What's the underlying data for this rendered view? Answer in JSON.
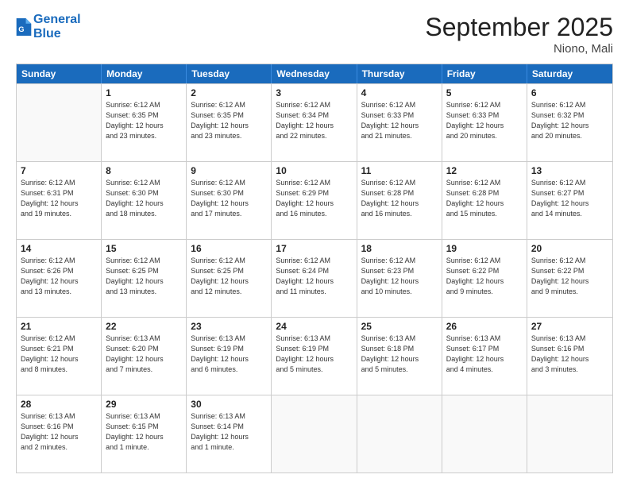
{
  "logo": {
    "line1": "General",
    "line2": "Blue"
  },
  "title": "September 2025",
  "location": "Niono, Mali",
  "header_days": [
    "Sunday",
    "Monday",
    "Tuesday",
    "Wednesday",
    "Thursday",
    "Friday",
    "Saturday"
  ],
  "rows": [
    [
      {
        "day": "",
        "info": ""
      },
      {
        "day": "1",
        "info": "Sunrise: 6:12 AM\nSunset: 6:35 PM\nDaylight: 12 hours\nand 23 minutes."
      },
      {
        "day": "2",
        "info": "Sunrise: 6:12 AM\nSunset: 6:35 PM\nDaylight: 12 hours\nand 23 minutes."
      },
      {
        "day": "3",
        "info": "Sunrise: 6:12 AM\nSunset: 6:34 PM\nDaylight: 12 hours\nand 22 minutes."
      },
      {
        "day": "4",
        "info": "Sunrise: 6:12 AM\nSunset: 6:33 PM\nDaylight: 12 hours\nand 21 minutes."
      },
      {
        "day": "5",
        "info": "Sunrise: 6:12 AM\nSunset: 6:33 PM\nDaylight: 12 hours\nand 20 minutes."
      },
      {
        "day": "6",
        "info": "Sunrise: 6:12 AM\nSunset: 6:32 PM\nDaylight: 12 hours\nand 20 minutes."
      }
    ],
    [
      {
        "day": "7",
        "info": "Sunrise: 6:12 AM\nSunset: 6:31 PM\nDaylight: 12 hours\nand 19 minutes."
      },
      {
        "day": "8",
        "info": "Sunrise: 6:12 AM\nSunset: 6:30 PM\nDaylight: 12 hours\nand 18 minutes."
      },
      {
        "day": "9",
        "info": "Sunrise: 6:12 AM\nSunset: 6:30 PM\nDaylight: 12 hours\nand 17 minutes."
      },
      {
        "day": "10",
        "info": "Sunrise: 6:12 AM\nSunset: 6:29 PM\nDaylight: 12 hours\nand 16 minutes."
      },
      {
        "day": "11",
        "info": "Sunrise: 6:12 AM\nSunset: 6:28 PM\nDaylight: 12 hours\nand 16 minutes."
      },
      {
        "day": "12",
        "info": "Sunrise: 6:12 AM\nSunset: 6:28 PM\nDaylight: 12 hours\nand 15 minutes."
      },
      {
        "day": "13",
        "info": "Sunrise: 6:12 AM\nSunset: 6:27 PM\nDaylight: 12 hours\nand 14 minutes."
      }
    ],
    [
      {
        "day": "14",
        "info": "Sunrise: 6:12 AM\nSunset: 6:26 PM\nDaylight: 12 hours\nand 13 minutes."
      },
      {
        "day": "15",
        "info": "Sunrise: 6:12 AM\nSunset: 6:25 PM\nDaylight: 12 hours\nand 13 minutes."
      },
      {
        "day": "16",
        "info": "Sunrise: 6:12 AM\nSunset: 6:25 PM\nDaylight: 12 hours\nand 12 minutes."
      },
      {
        "day": "17",
        "info": "Sunrise: 6:12 AM\nSunset: 6:24 PM\nDaylight: 12 hours\nand 11 minutes."
      },
      {
        "day": "18",
        "info": "Sunrise: 6:12 AM\nSunset: 6:23 PM\nDaylight: 12 hours\nand 10 minutes."
      },
      {
        "day": "19",
        "info": "Sunrise: 6:12 AM\nSunset: 6:22 PM\nDaylight: 12 hours\nand 9 minutes."
      },
      {
        "day": "20",
        "info": "Sunrise: 6:12 AM\nSunset: 6:22 PM\nDaylight: 12 hours\nand 9 minutes."
      }
    ],
    [
      {
        "day": "21",
        "info": "Sunrise: 6:12 AM\nSunset: 6:21 PM\nDaylight: 12 hours\nand 8 minutes."
      },
      {
        "day": "22",
        "info": "Sunrise: 6:13 AM\nSunset: 6:20 PM\nDaylight: 12 hours\nand 7 minutes."
      },
      {
        "day": "23",
        "info": "Sunrise: 6:13 AM\nSunset: 6:19 PM\nDaylight: 12 hours\nand 6 minutes."
      },
      {
        "day": "24",
        "info": "Sunrise: 6:13 AM\nSunset: 6:19 PM\nDaylight: 12 hours\nand 5 minutes."
      },
      {
        "day": "25",
        "info": "Sunrise: 6:13 AM\nSunset: 6:18 PM\nDaylight: 12 hours\nand 5 minutes."
      },
      {
        "day": "26",
        "info": "Sunrise: 6:13 AM\nSunset: 6:17 PM\nDaylight: 12 hours\nand 4 minutes."
      },
      {
        "day": "27",
        "info": "Sunrise: 6:13 AM\nSunset: 6:16 PM\nDaylight: 12 hours\nand 3 minutes."
      }
    ],
    [
      {
        "day": "28",
        "info": "Sunrise: 6:13 AM\nSunset: 6:16 PM\nDaylight: 12 hours\nand 2 minutes."
      },
      {
        "day": "29",
        "info": "Sunrise: 6:13 AM\nSunset: 6:15 PM\nDaylight: 12 hours\nand 1 minute."
      },
      {
        "day": "30",
        "info": "Sunrise: 6:13 AM\nSunset: 6:14 PM\nDaylight: 12 hours\nand 1 minute."
      },
      {
        "day": "",
        "info": ""
      },
      {
        "day": "",
        "info": ""
      },
      {
        "day": "",
        "info": ""
      },
      {
        "day": "",
        "info": ""
      }
    ]
  ]
}
